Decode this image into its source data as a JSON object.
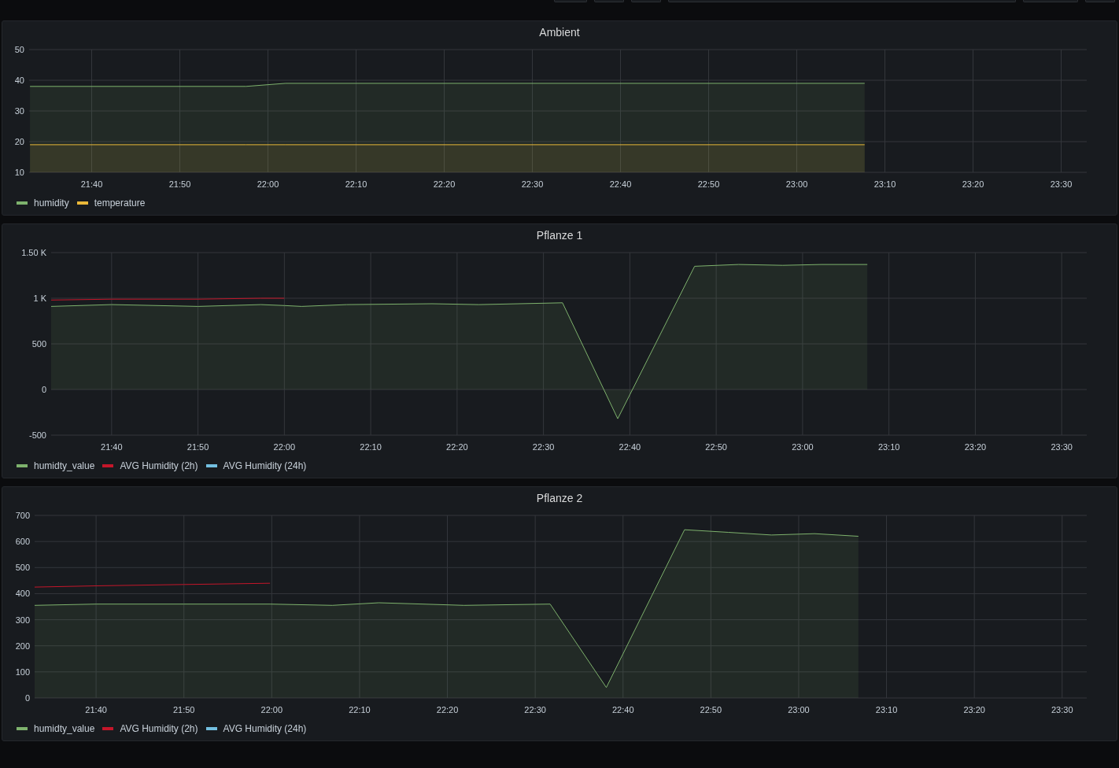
{
  "panels": [
    {
      "title": "Ambient",
      "chart_data": {
        "type": "area",
        "grid": true,
        "x": [
          1293,
          1317.5,
          1322,
          1387.7
        ],
        "xlim": [
          1292.9,
          1412.9
        ],
        "ylim": [
          10,
          50
        ],
        "xticks": [
          {
            "value": 1300,
            "label": "21:40"
          },
          {
            "value": 1310,
            "label": "21:50"
          },
          {
            "value": 1320,
            "label": "22:00"
          },
          {
            "value": 1330,
            "label": "22:10"
          },
          {
            "value": 1340,
            "label": "22:20"
          },
          {
            "value": 1350,
            "label": "22:30"
          },
          {
            "value": 1360,
            "label": "22:40"
          },
          {
            "value": 1370,
            "label": "22:50"
          },
          {
            "value": 1380,
            "label": "23:00"
          },
          {
            "value": 1390,
            "label": "23:10"
          },
          {
            "value": 1400,
            "label": "23:20"
          },
          {
            "value": 1410,
            "label": "23:30"
          }
        ],
        "yticks": [
          10,
          20,
          30,
          40,
          50
        ],
        "series": [
          {
            "name": "humidity",
            "color": "#7eb26d",
            "type": "area",
            "values": [
              38,
              38,
              39,
              39
            ]
          },
          {
            "name": "temperature",
            "color": "#eab839",
            "type": "area",
            "values": [
              19,
              19,
              19,
              19
            ]
          }
        ]
      }
    },
    {
      "title": "Pflanze 1",
      "chart_data": {
        "type": "area",
        "grid": true,
        "x": [
          1293,
          1300,
          1310,
          1317.3,
          1320,
          1322,
          1327.2,
          1337.1,
          1342.5,
          1352.2,
          1358.6,
          1367.5,
          1372.6,
          1377.7,
          1382.2,
          1387.5
        ],
        "xlim": [
          1293,
          1412.9
        ],
        "ylim": [
          -500,
          1500
        ],
        "xticks": [
          {
            "value": 1300,
            "label": "21:40"
          },
          {
            "value": 1310,
            "label": "21:50"
          },
          {
            "value": 1320,
            "label": "22:00"
          },
          {
            "value": 1330,
            "label": "22:10"
          },
          {
            "value": 1340,
            "label": "22:20"
          },
          {
            "value": 1350,
            "label": "22:30"
          },
          {
            "value": 1360,
            "label": "22:40"
          },
          {
            "value": 1370,
            "label": "22:50"
          },
          {
            "value": 1380,
            "label": "23:00"
          },
          {
            "value": 1390,
            "label": "23:10"
          },
          {
            "value": 1400,
            "label": "23:20"
          },
          {
            "value": 1410,
            "label": "23:30"
          }
        ],
        "yticks": [
          {
            "value": -500,
            "label": "-500"
          },
          {
            "value": 0,
            "label": "0"
          },
          {
            "value": 500,
            "label": "500"
          },
          {
            "value": 1000,
            "label": "1 K"
          },
          {
            "value": 1500,
            "label": "1.50 K"
          }
        ],
        "series": [
          {
            "name": "humidty_value",
            "color": "#7eb26d",
            "type": "area",
            "values": [
              910,
              930,
              910,
              930,
              920,
              910,
              930,
              940,
              930,
              950,
              -320,
              1350,
              1370,
              1360,
              1370,
              1370
            ]
          },
          {
            "name": "AVG Humidity (2h)",
            "color": "#c4162a",
            "type": "line",
            "values": [
              980,
              990,
              990,
              1000,
              1000,
              null,
              null,
              null,
              null,
              null,
              null,
              null,
              null,
              null,
              null,
              null
            ]
          },
          {
            "name": "AVG Humidity (24h)",
            "color": "#73bfe0",
            "values": [
              null,
              null,
              null,
              null,
              null,
              null,
              null,
              null,
              null,
              null,
              null,
              null,
              null,
              null,
              null,
              null
            ]
          }
        ]
      }
    },
    {
      "title": "Pflanze 2",
      "chart_data": {
        "type": "area",
        "grid": true,
        "x": [
          1293,
          1300,
          1310,
          1319.8,
          1326.9,
          1332.2,
          1341.9,
          1351.7,
          1358.1,
          1367,
          1372,
          1376.9,
          1381.8,
          1386.8
        ],
        "xlim": [
          1293,
          1412.8
        ],
        "ylim": [
          0,
          700
        ],
        "xticks": [
          {
            "value": 1300,
            "label": "21:40"
          },
          {
            "value": 1310,
            "label": "21:50"
          },
          {
            "value": 1320,
            "label": "22:00"
          },
          {
            "value": 1330,
            "label": "22:10"
          },
          {
            "value": 1340,
            "label": "22:20"
          },
          {
            "value": 1350,
            "label": "22:30"
          },
          {
            "value": 1360,
            "label": "22:40"
          },
          {
            "value": 1370,
            "label": "22:50"
          },
          {
            "value": 1380,
            "label": "23:00"
          },
          {
            "value": 1390,
            "label": "23:10"
          },
          {
            "value": 1400,
            "label": "23:20"
          },
          {
            "value": 1410,
            "label": "23:30"
          }
        ],
        "yticks": [
          0,
          100,
          200,
          300,
          400,
          500,
          600,
          700
        ],
        "series": [
          {
            "name": "humidty_value",
            "color": "#7eb26d",
            "type": "area",
            "values": [
              355,
              360,
              360,
              360,
              355,
              365,
              355,
              360,
              40,
              645,
              635,
              625,
              630,
              620
            ]
          },
          {
            "name": "AVG Humidity (2h)",
            "color": "#c4162a",
            "type": "line",
            "values": [
              425,
              430,
              435,
              440,
              null,
              null,
              null,
              null,
              null,
              null,
              null,
              null,
              null,
              null
            ]
          },
          {
            "name": "AVG Humidity (24h)",
            "color": "#73bfe0",
            "values": [
              null,
              null,
              null,
              null,
              null,
              null,
              null,
              null,
              null,
              null,
              null,
              null,
              null,
              null
            ]
          }
        ]
      }
    }
  ]
}
